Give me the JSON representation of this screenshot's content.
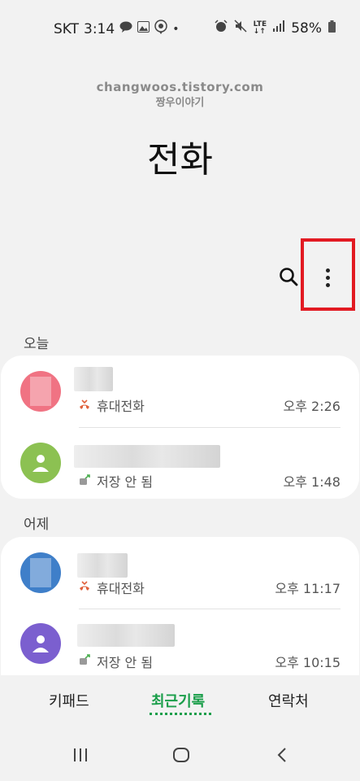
{
  "status_bar": {
    "carrier": "SKT",
    "time": "3:14",
    "notifications": [
      "talk-icon",
      "gallery-icon",
      "location-icon",
      "dot"
    ],
    "system_icons": [
      "alarm-icon",
      "mute-icon",
      "lte-icon",
      "signal-icon"
    ],
    "battery": "58%"
  },
  "watermark": {
    "line1": "changwoos.tistory.com",
    "line2": "짱우이야기"
  },
  "header": {
    "title": "전화"
  },
  "toolbar": {
    "search_icon": "search-icon",
    "more_icon": "more-vertical-icon"
  },
  "sections": [
    {
      "label": "오늘",
      "rows": [
        {
          "call_type": "휴대전화",
          "time": "오후 2:26",
          "icon": "missed-call-icon",
          "avatar_color": "#f07383"
        },
        {
          "call_type": "저장 안 됨",
          "time": "오후 1:48",
          "icon": "outgoing-call-icon",
          "avatar_color": "#8cc152"
        }
      ]
    },
    {
      "label": "어제",
      "rows": [
        {
          "call_type": "휴대전화",
          "time": "오후 11:17",
          "icon": "missed-call-icon",
          "avatar_color": "#3f7fc9"
        },
        {
          "call_type": "저장 안 됨",
          "time": "오후 10:15",
          "icon": "outgoing-call-icon",
          "avatar_color": "#7b5fcf"
        }
      ]
    }
  ],
  "tabs": {
    "keypad": "키패드",
    "recents": "최근기록",
    "contacts": "연락처"
  },
  "colors": {
    "accent": "#1a9e4a",
    "highlight": "#e21a22",
    "missed": "#e0603b",
    "outgoing": "#4caf50"
  }
}
